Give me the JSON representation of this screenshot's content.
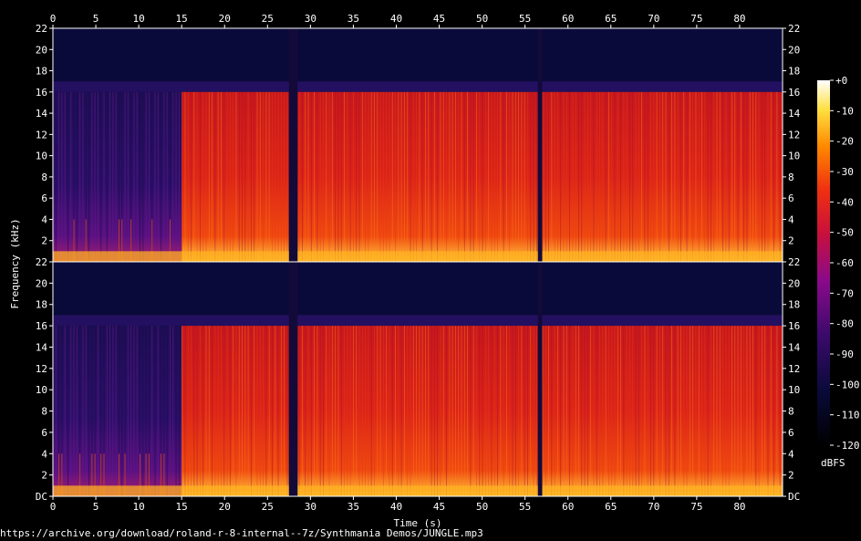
{
  "chart_data": {
    "type": "heatmap",
    "title": "",
    "xlabel": "Time (s)",
    "ylabel": "Frequency (kHz)",
    "xlim": [
      0,
      85
    ],
    "x_ticks": [
      0,
      5,
      10,
      15,
      20,
      25,
      30,
      35,
      40,
      45,
      50,
      55,
      60,
      65,
      70,
      75,
      80
    ],
    "ylim_khz": [
      0,
      22
    ],
    "y_ticks": [
      "DC",
      "2",
      "4",
      "6",
      "8",
      "10",
      "12",
      "14",
      "16",
      "18",
      "20",
      "22"
    ],
    "channels": 2,
    "frequency_cutoff_khz": 16,
    "colorbar": {
      "label": "dBFS",
      "ticks": [
        "+0",
        "-10",
        "-20",
        "-30",
        "-40",
        "-50",
        "-60",
        "-70",
        "-80",
        "-90",
        "-100",
        "-110",
        "-120"
      ],
      "range": [
        -120,
        0
      ]
    },
    "segments_seconds": [
      {
        "from": 0,
        "to": 15,
        "level": "quiet"
      },
      {
        "from": 15,
        "to": 27.5,
        "level": "loud"
      },
      {
        "from": 27.5,
        "to": 28.5,
        "level": "gap"
      },
      {
        "from": 28.5,
        "to": 56.5,
        "level": "loud"
      },
      {
        "from": 56.5,
        "to": 57,
        "level": "gap"
      },
      {
        "from": 57,
        "to": 85,
        "level": "loud"
      }
    ],
    "colors": {
      "background": "#000000",
      "low": "#000033",
      "mid": "#5a0a8c",
      "high": "#e0201c",
      "peak": "#ffff80"
    }
  },
  "footer": "https://archive.org/download/roland-r-8-internal--7z/Synthmania Demos/JUNGLE.mp3"
}
